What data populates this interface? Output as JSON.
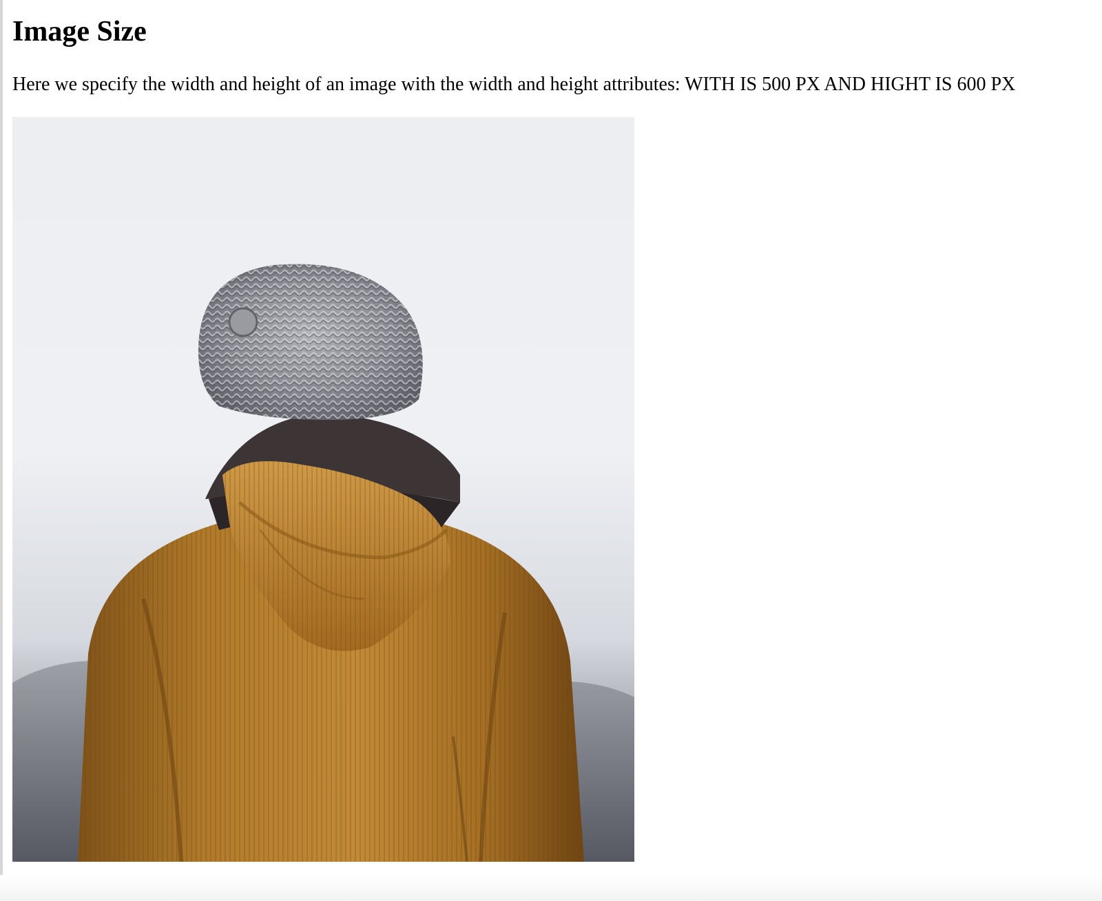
{
  "page": {
    "heading": "Image Size",
    "description": "Here we specify the width and height of an image with the width and height attributes: WITH IS 500 PX AND HIGHT IS 600 PX"
  },
  "image": {
    "subject": "person-in-beanie-and-corduroy-jacket-back-view",
    "colors": {
      "sky": "#eef0f4",
      "haze": "#c9ccd3",
      "jacket": "#b07a2a",
      "jacket_shadow": "#7a4f16",
      "scarf": "#3d3436",
      "beanie": "#8e8e94"
    }
  }
}
